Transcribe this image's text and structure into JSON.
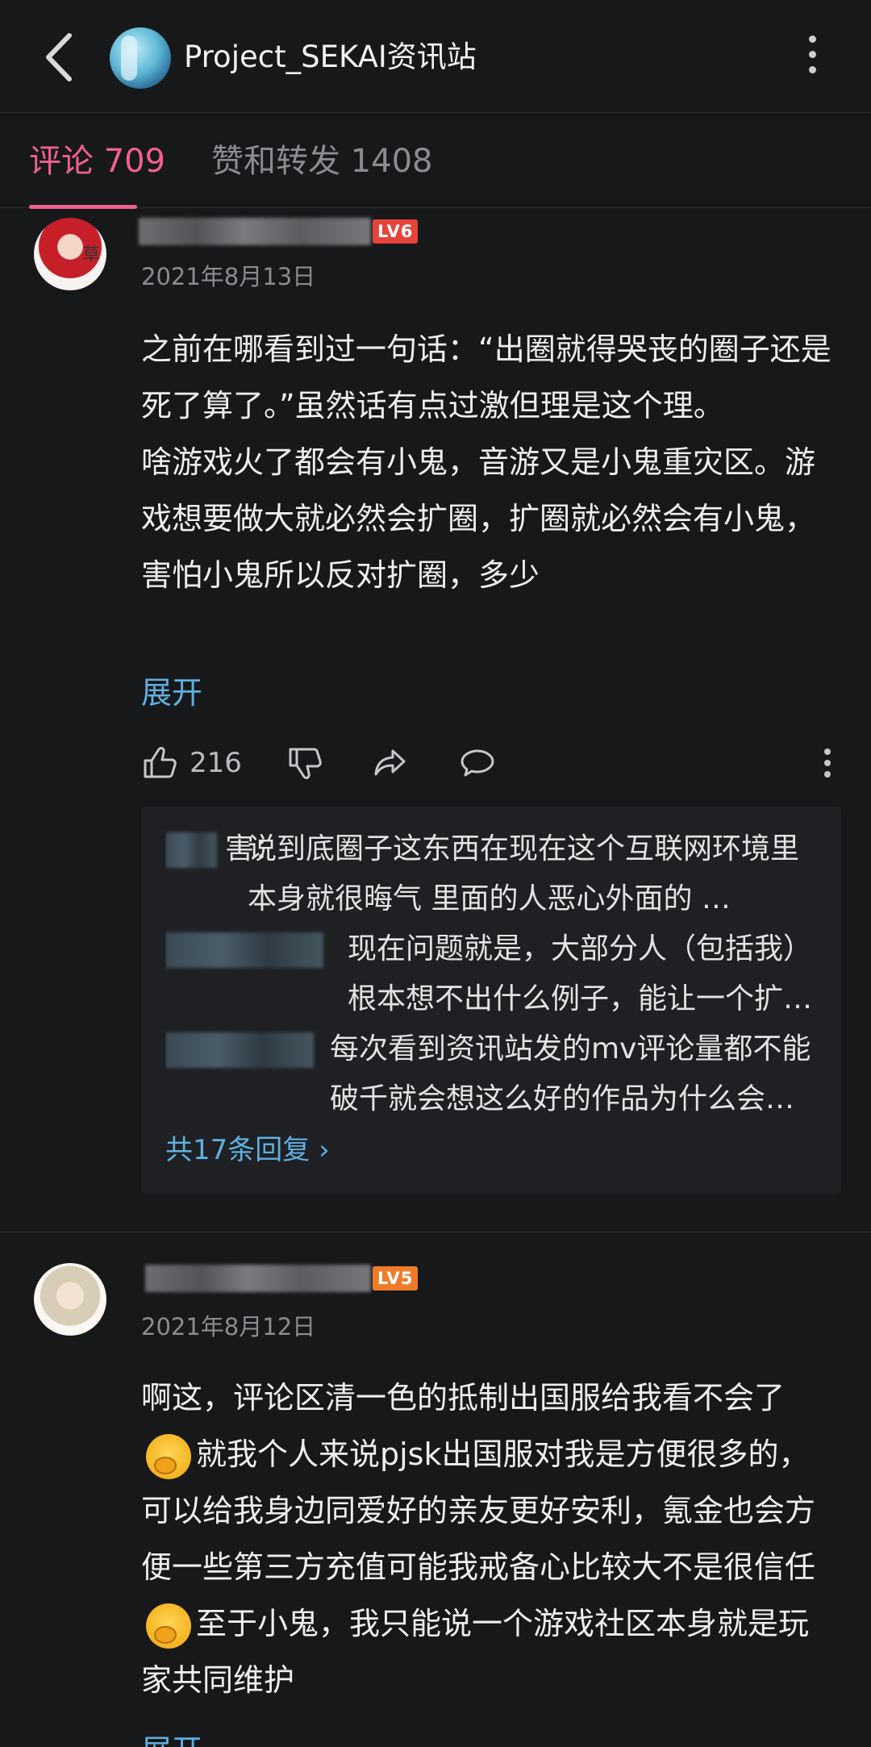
{
  "header": {
    "title": "Project_SEKAI资讯站",
    "back_icon": "chevron-left-icon",
    "more_icon": "more-vertical-icon"
  },
  "tabs": [
    {
      "label": "评论 709",
      "active": true
    },
    {
      "label": "赞和转发 1408",
      "active": false
    }
  ],
  "colors": {
    "accent": "#f0608e",
    "link": "#5fb0e0",
    "background": "#17181a"
  },
  "comments": [
    {
      "avatar_badge": "草",
      "level": "LV6",
      "date": "2021年8月13日",
      "body": "之前在哪看到过一句话：“出圈就得哭丧的圈子还是死了算了。”虽然话有点过激但理是这个理。\n啥游戏火了都会有小鬼，音游又是小鬼重灾区。游戏想要做大就必然会扩圈，扩圈就必然会有小鬼，害怕小鬼所以反对扩圈，多少",
      "expand_label": "展开",
      "likes": "216",
      "replies": [
        {
          "text": "说到底圈子这东西在现在这个互联网环境里本身就很晦气 里面的人恶心外面的 …",
          "prefix": "：",
          "prefix_char": "害"
        },
        {
          "text": "现在问题就是，大部分人（包括我）根本想不出什么例子，能让一个扩…"
        },
        {
          "text": "每次看到资讯站发的mv评论量都不能破千就会想这么好的作品为什么会…"
        }
      ],
      "reply_more": "共17条回复 ›"
    },
    {
      "level": "LV5",
      "date": "2021年8月12日",
      "body_parts": [
        "啊这，评论区清一色的抵制出国服给我看不会了",
        "就我个人来说pjsk出国服对我是方便很多的，可以给我身边同爱好的亲友更好安利，氪金也会方便一些第三方充值可能我戒备心比较大不是很信任",
        "至于小鬼，我只能说一个游戏社区本身就是玩家共同维护"
      ],
      "expand_label": "展开"
    }
  ]
}
